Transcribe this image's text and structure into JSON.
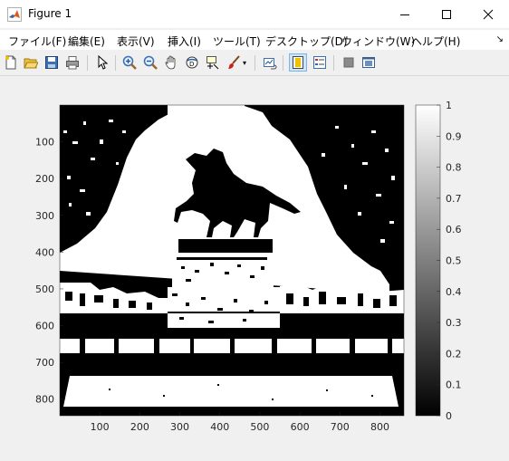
{
  "window": {
    "title": "Figure 1",
    "accent": "#0078d7"
  },
  "menu": {
    "items": [
      {
        "label": "ファイル(F)"
      },
      {
        "label": "編集(E)"
      },
      {
        "label": "表示(V)"
      },
      {
        "label": "挿入(I)"
      },
      {
        "label": "ツール(T)"
      },
      {
        "label": "デスクトップ(D)"
      },
      {
        "label": "ウィンドウ(W)"
      },
      {
        "label": "ヘルプ(H)"
      }
    ]
  },
  "toolbar": {
    "buttons": [
      {
        "icon": "new-figure-icon"
      },
      {
        "icon": "open-file-icon"
      },
      {
        "icon": "save-icon"
      },
      {
        "icon": "print-icon"
      },
      {
        "icon": "edit-plot-arrow-icon"
      },
      {
        "icon": "zoom-in-icon"
      },
      {
        "icon": "zoom-out-icon"
      },
      {
        "icon": "pan-hand-icon"
      },
      {
        "icon": "rotate-3d-icon"
      },
      {
        "icon": "data-cursor-icon"
      },
      {
        "icon": "brush-icon"
      },
      {
        "icon": "link-plot-icon"
      },
      {
        "icon": "colorbar-icon"
      },
      {
        "icon": "legend-icon"
      },
      {
        "icon": "hide-plot-tools-icon"
      },
      {
        "icon": "show-plot-tools-icon"
      }
    ]
  },
  "axes": {
    "x_ticks": [
      "100",
      "200",
      "300",
      "400",
      "500",
      "600",
      "700",
      "800"
    ],
    "y_ticks": [
      "100",
      "200",
      "300",
      "400",
      "500",
      "600",
      "700",
      "800"
    ]
  },
  "colorbar": {
    "ticks": [
      "0",
      "0.1",
      "0.2",
      "0.3",
      "0.4",
      "0.5",
      "0.6",
      "0.7",
      "0.8",
      "0.9",
      "1"
    ],
    "colormap": "gray"
  }
}
